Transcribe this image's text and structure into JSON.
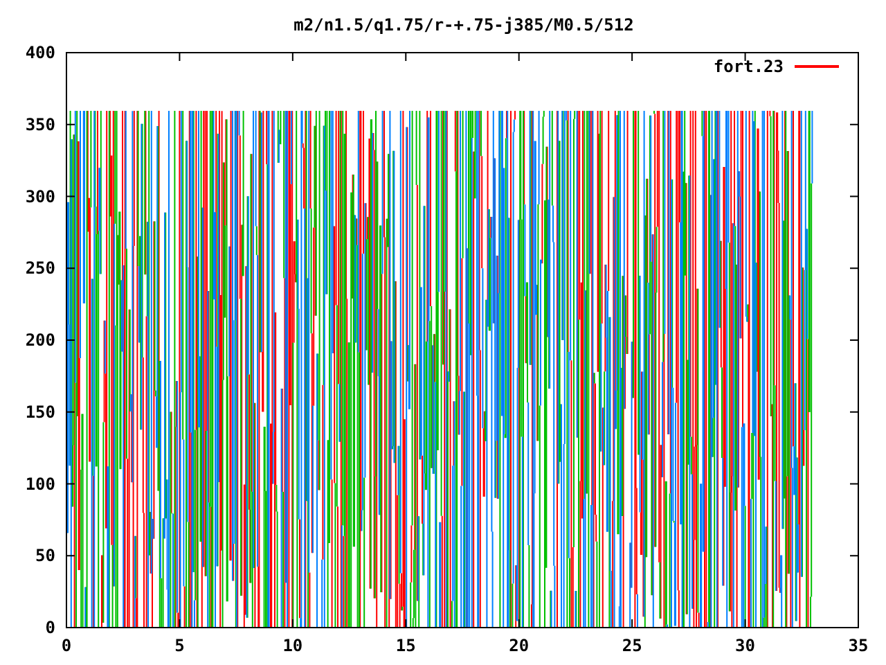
{
  "title": "m2/n1.5/q1.75/r-+.75-j385/M0.5/512",
  "x_axis": {
    "ticks": [
      "0",
      "5",
      "10",
      "15",
      "20",
      "25",
      "30",
      "35"
    ]
  },
  "y_axis": {
    "ticks": [
      "400",
      "350",
      "300",
      "250",
      "200",
      "150",
      "100",
      "50",
      "0"
    ]
  },
  "legend": [
    {
      "label": "fort.23",
      "color": "#ff0000"
    }
  ]
}
